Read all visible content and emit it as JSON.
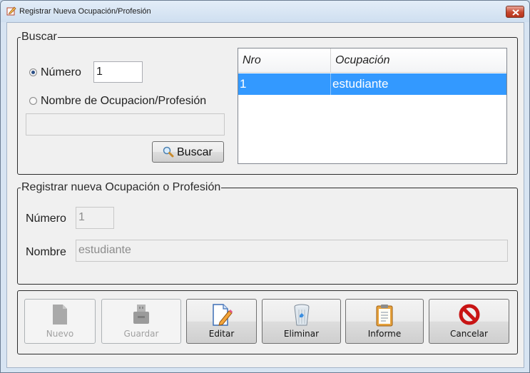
{
  "window": {
    "title": "Registrar Nueva Ocupación/Profesión"
  },
  "buscar": {
    "legend": "Buscar",
    "radio_numero_label": "Número",
    "radio_nombre_label": "Nombre de Ocupacion/Profesión",
    "numero_value": "1",
    "nombre_value": "",
    "search_button_label": "Buscar",
    "table": {
      "columns": [
        "Nro",
        "Ocupación"
      ],
      "rows": [
        {
          "nro": "1",
          "ocupacion": "estudiante",
          "selected": true
        }
      ]
    }
  },
  "registrar": {
    "legend": "Registrar nueva Ocupación o Profesión",
    "numero_label": "Número",
    "numero_value": "1",
    "nombre_label": "Nombre",
    "nombre_value": "estudiante"
  },
  "toolbar": {
    "nuevo": "Nuevo",
    "guardar": "Guardar",
    "editar": "Editar",
    "eliminar": "Eliminar",
    "informe": "Informe",
    "cancelar": "Cancelar"
  },
  "colors": {
    "selection": "#3399ff",
    "titlebar": "#d7e4f2",
    "close_button": "#c6462d"
  }
}
